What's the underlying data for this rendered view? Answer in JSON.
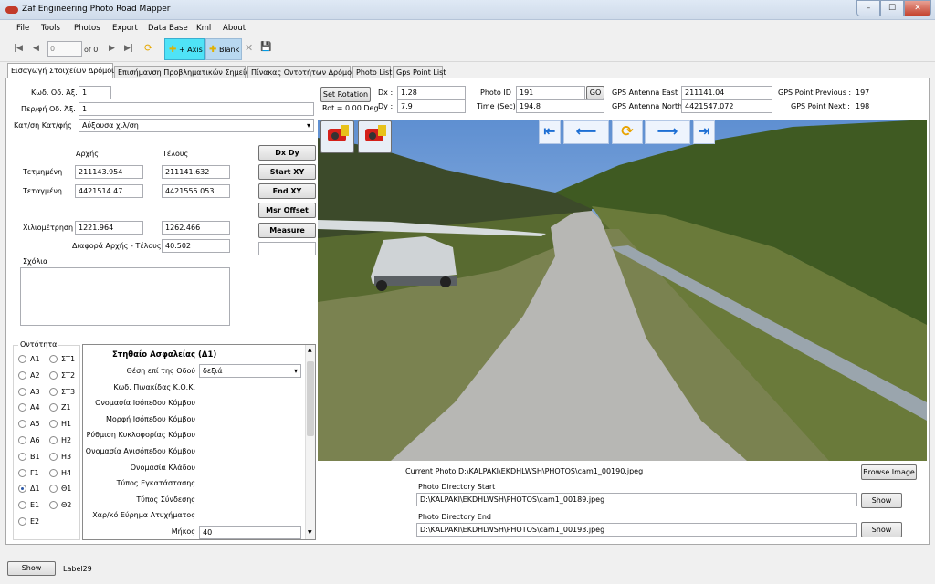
{
  "window": {
    "title": "Zaf Engineering Photo Road Mapper",
    "min": "–",
    "max": "☐",
    "close": "✕"
  },
  "menu": [
    "File",
    "Tools",
    "Photos",
    "Export",
    "Data Base",
    "Kml",
    "About"
  ],
  "toolbar": {
    "first": "|◀",
    "prev": "◀",
    "position": "0",
    "of": "of 0",
    "next": "▶",
    "last": "▶|",
    "refresh": "⟳",
    "axis_label": "+ Axis",
    "blank_label": "Blank",
    "delete": "✕",
    "save": "💾"
  },
  "tabs": [
    "Εισαγωγή Στοιχείων Δρόμου",
    "Επισήμανση Προβληματικών Σημείων",
    "Πίνακας Οντοτήτων Δρόμου",
    "Photo List",
    "Gps Point List"
  ],
  "road": {
    "code_label": "Κωδ. Οδ. Άξ.",
    "code_value": "1",
    "desc_label": "Περ/φή Οδ. Άξ.",
    "desc_value": "1",
    "dir_label": "Κατ/ση Κατ/φής",
    "dir_value": "Αύξουσα χιλ/ση",
    "start_header": "Αρχής",
    "end_header": "Τέλους",
    "abscissa_label": "Τετμημένη",
    "abscissa_start": "211143.954",
    "abscissa_end": "211141.632",
    "ordinate_label": "Τεταγμένη",
    "ordinate_start": "4421514.47",
    "ordinate_end": "4421555.053",
    "chainage_label": "Χιλιομέτρηση",
    "chainage_start": "1221.964",
    "chainage_end": "1262.466",
    "diff_label": "Διαφορά Αρχής - Τέλους",
    "diff_value": "40.502",
    "comments_label": "Σχόλια"
  },
  "buttons": {
    "dxdy": "Dx Dy",
    "start_xy": "Start XY",
    "end_xy": "End XY",
    "msr_offset": "Msr Offset",
    "measure": "Measure"
  },
  "entity": {
    "label": "Οντότητα",
    "left": [
      "Α1",
      "Α2",
      "Α3",
      "Α4",
      "Α5",
      "Α6",
      "Β1",
      "Γ1",
      "Δ1",
      "Ε1",
      "Ε2"
    ],
    "right": [
      "ΣΤ1",
      "ΣΤ2",
      "ΣΤ3",
      "Ζ1",
      "Η1",
      "Η2",
      "Η3",
      "Η4",
      "Θ1",
      "Θ2"
    ],
    "selected": "Δ1"
  },
  "props": {
    "title": "Στηθαίο Ασφαλείας (Δ1)",
    "rows": [
      "Θέση επί της Οδού",
      "Κωδ. Πινακίδας Κ.Ο.Κ.",
      "Ονομασία Ισόπεδου Κόμβου",
      "Μορφή Ισόπεδου Κόμβου",
      "Ρύθμιση Κυκλοφορίας Κόμβου",
      "Ονομασία Ανισόπεδου Κόμβου",
      "Ονομασία Κλάδου",
      "Τύπος Εγκατάστασης",
      "Τύπος Σύνδεσης",
      "Χαρ/κό Εύρημα Ατυχήματος",
      "Μήκος"
    ],
    "position_value": "δεξιά",
    "length_value": "40"
  },
  "photo_params": {
    "set_rotation": "Set Rotation",
    "rot": "Rot = 0.00 Deg",
    "dx_label": "Dx :",
    "dx_value": "1.28",
    "dy_label": "Dy :",
    "dy_value": "7.9",
    "photo_id_label": "Photo ID",
    "photo_id_value": "191",
    "go": "GO",
    "time_label": "Time (Sec)",
    "time_value": "194.8",
    "gps_east_label": "GPS Antenna East",
    "gps_east_value": "211141.04",
    "gps_north_label": "GPS Antenna North",
    "gps_north_value": "4421547.072",
    "gps_prev_label": "GPS Point Previous :",
    "gps_prev_value": "197",
    "gps_next_label": "GPS Point Next :",
    "gps_next_value": "198"
  },
  "photo_nav": {
    "first": "⇤",
    "prev": "⟵",
    "refresh": "⟳",
    "next": "⟶",
    "last": "⇥"
  },
  "photo_paths": {
    "current_label": "Current Photo",
    "current_value": "D:\\KALPAKI\\EKDHLWSH\\PHOTOS\\cam1_00190.jpeg",
    "browse": "Browse Image",
    "start_label": "Photo Directory Start",
    "start_value": "D:\\KALPAKI\\EKDHLWSH\\PHOTOS\\cam1_00189.jpeg",
    "end_label": "Photo Directory End",
    "end_value": "D:\\KALPAKI\\EKDHLWSH\\PHOTOS\\cam1_00193.jpeg",
    "show": "Show"
  },
  "status": {
    "show": "Show",
    "label": "Label29"
  },
  "colors": {
    "axis_bg": "#4fe3f7",
    "sky": "#8fb6e6",
    "road": "#b5b5b2",
    "hills": "#3e5a24",
    "arrow": "#1d6fd4"
  }
}
